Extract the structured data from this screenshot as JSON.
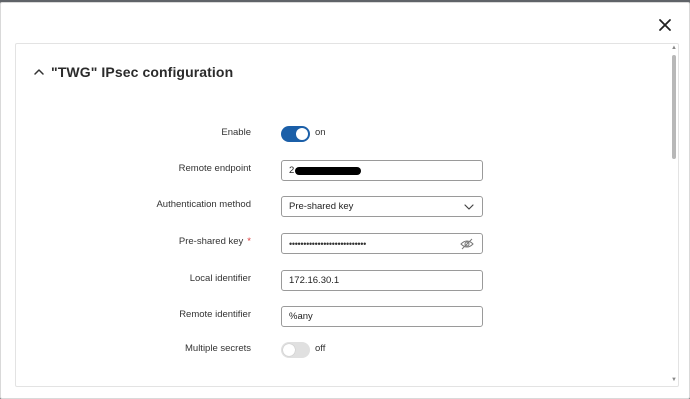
{
  "dialog": {
    "close_icon": "close-icon"
  },
  "section": {
    "title": "\"TWG\" IPsec configuration",
    "collapse_icon": "chevron-up-icon"
  },
  "form": {
    "enable": {
      "label": "Enable",
      "state": "on"
    },
    "remote_endpoint": {
      "label": "Remote endpoint",
      "value": "2"
    },
    "auth_method": {
      "label": "Authentication method",
      "value": "Pre-shared key"
    },
    "pre_shared_key": {
      "label": "Pre-shared key",
      "required_mark": "*",
      "value": "•••••••••••••••••••••••••••"
    },
    "local_identifier": {
      "label": "Local identifier",
      "value": "172.16.30.1"
    },
    "remote_identifier": {
      "label": "Remote identifier",
      "value": "%any"
    },
    "multiple_secrets": {
      "label": "Multiple secrets",
      "state": "off"
    }
  },
  "colors": {
    "toggle_on": "#1b5fa8",
    "toggle_off": "#e0e0e0",
    "required": "#d93a3a"
  }
}
